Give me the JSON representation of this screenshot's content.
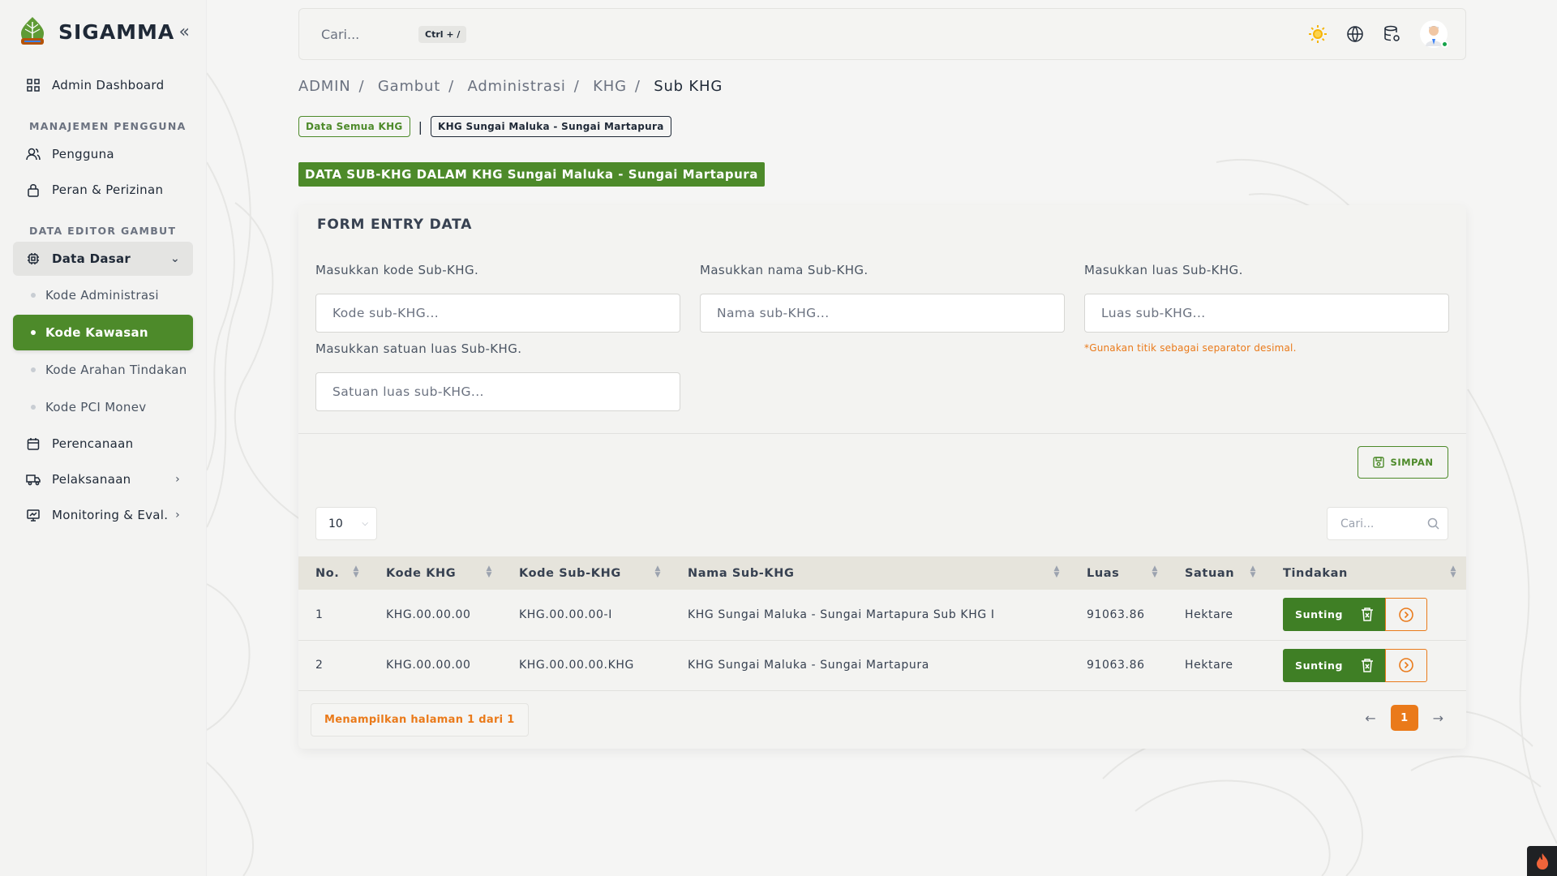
{
  "app": {
    "name": "SIGAMMA"
  },
  "sidebar": {
    "dashboard": "Admin Dashboard",
    "section_users": "MANAJEMEN PENGGUNA",
    "users": "Pengguna",
    "roles": "Peran & Perizinan",
    "section_editor": "DATA EDITOR GAMBUT",
    "data_dasar": "Data Dasar",
    "sub_items": [
      "Kode Administrasi",
      "Kode Kawasan",
      "Kode Arahan Tindakan",
      "Kode PCI Monev"
    ],
    "perencanaan": "Perencanaan",
    "pelaksanaan": "Pelaksanaan",
    "monitoring": "Monitoring & Eval."
  },
  "topbar": {
    "search_placeholder": "Cari...",
    "shortcut": "Ctrl + /"
  },
  "breadcrumb": [
    "ADMIN",
    "Gambut",
    "Administrasi",
    "KHG",
    "Sub KHG"
  ],
  "chips": {
    "all": "Data Semua KHG",
    "current": "KHG Sungai Maluka - Sungai Martapura"
  },
  "section_label": "DATA SUB-KHG DALAM KHG Sungai Maluka - Sungai Martapura",
  "form": {
    "title": "FORM ENTRY DATA",
    "kode_label": "Masukkan kode Sub-KHG.",
    "kode_placeholder": "Kode sub-KHG...",
    "nama_label": "Masukkan nama Sub-KHG.",
    "nama_placeholder": "Nama sub-KHG...",
    "luas_label": "Masukkan luas Sub-KHG.",
    "luas_placeholder": "Luas sub-KHG...",
    "luas_hint": "*Gunakan titik sebagai separator desimal.",
    "satuan_label": "Masukkan satuan luas Sub-KHG.",
    "satuan_placeholder": "Satuan luas sub-KHG...",
    "save": "SIMPAN"
  },
  "table": {
    "page_size": "10",
    "search_placeholder": "Cari...",
    "columns": [
      "No.",
      "Kode KHG",
      "Kode Sub-KHG",
      "Nama Sub-KHG",
      "Luas",
      "Satuan",
      "Tindakan"
    ],
    "rows": [
      {
        "no": "1",
        "kode_khg": "KHG.00.00.00",
        "kode_sub": "KHG.00.00.00-I",
        "nama": "KHG Sungai Maluka - Sungai Martapura Sub KHG I",
        "luas": "91063.86",
        "satuan": "Hektare",
        "action": "Sunting"
      },
      {
        "no": "2",
        "kode_khg": "KHG.00.00.00",
        "kode_sub": "KHG.00.00.00.KHG",
        "nama": "KHG Sungai Maluka - Sungai Martapura",
        "luas": "91063.86",
        "satuan": "Hektare",
        "action": "Sunting"
      }
    ],
    "paging_info": "Menampilkan halaman 1 dari 1",
    "current_page": "1"
  },
  "colors": {
    "primary": "#4d8a2a",
    "accent": "#ea7a1a"
  }
}
